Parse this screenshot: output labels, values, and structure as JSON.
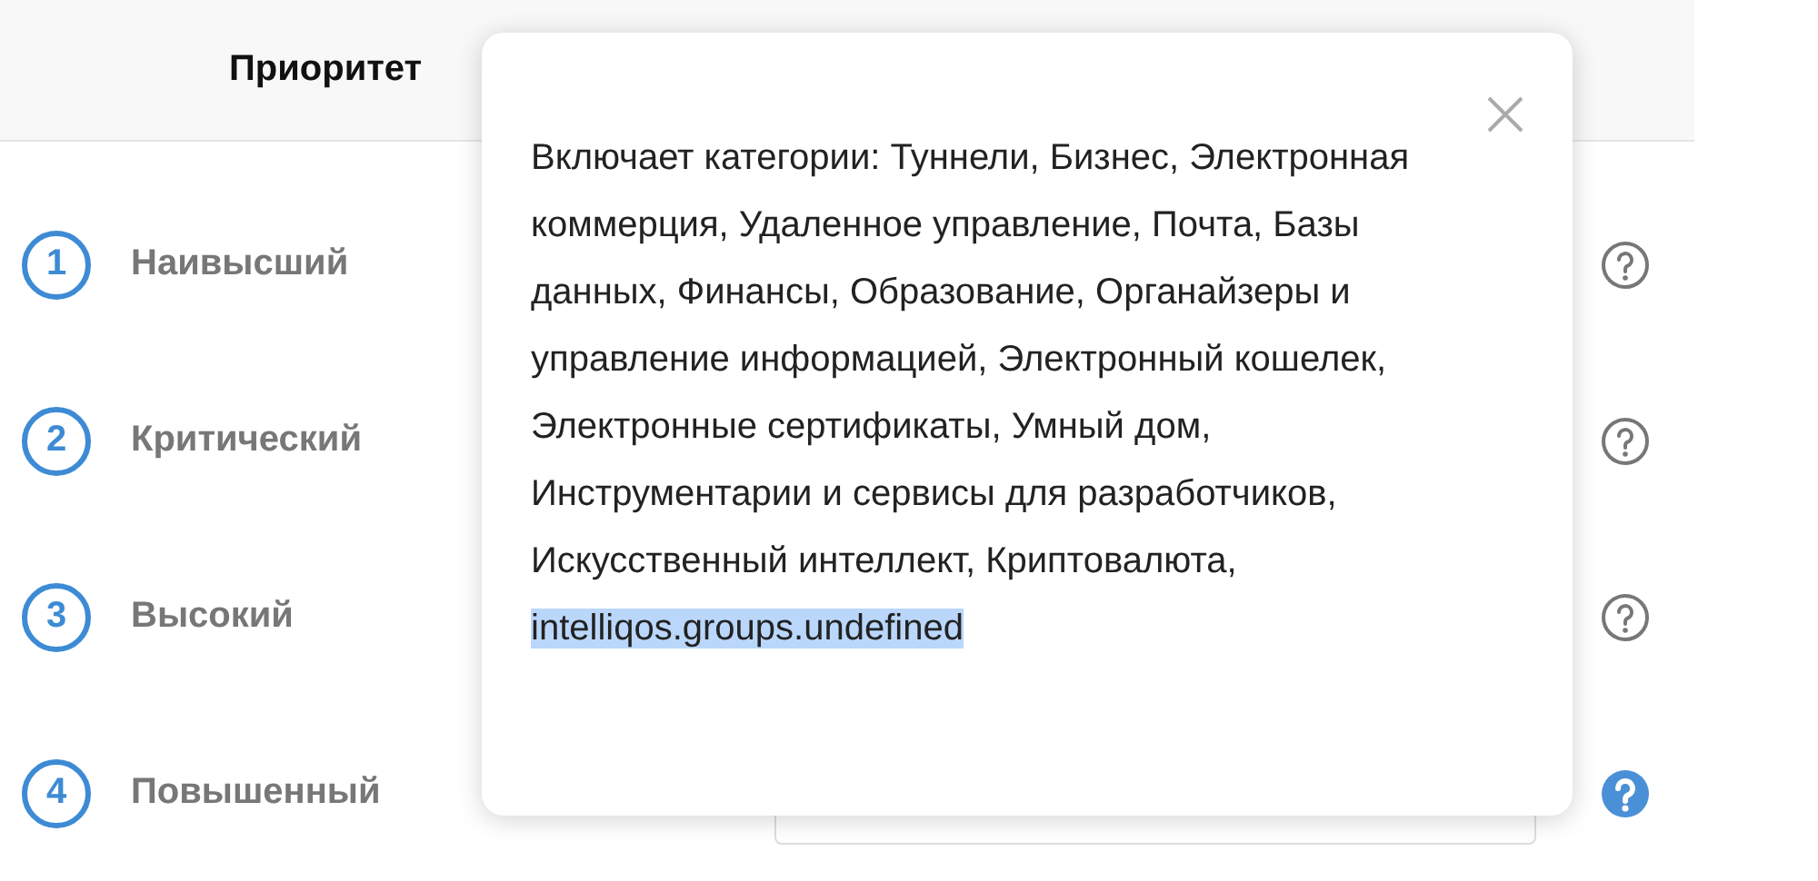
{
  "header": {
    "title": "Приоритет"
  },
  "priorities": [
    {
      "number": "1",
      "label": "Наивысший",
      "help_active": false
    },
    {
      "number": "2",
      "label": "Критический",
      "help_active": false
    },
    {
      "number": "3",
      "label": "Высокий",
      "help_active": false
    },
    {
      "number": "4",
      "label": "Повышенный",
      "help_active": true
    }
  ],
  "popup": {
    "text": "Включает категории: Туннели, Бизнес, Электронная коммерция, Удаленное управление, Почта, Базы данных, Финансы, Образование, Органайзеры и управление информацией, Электронный кошелек, Электронные сертификаты, Умный дом, Инструментарии и сервисы для разработчиков, Искусственный интеллект, Криптовалюта,",
    "selected_text": "intelliqos.groups.undefined"
  }
}
